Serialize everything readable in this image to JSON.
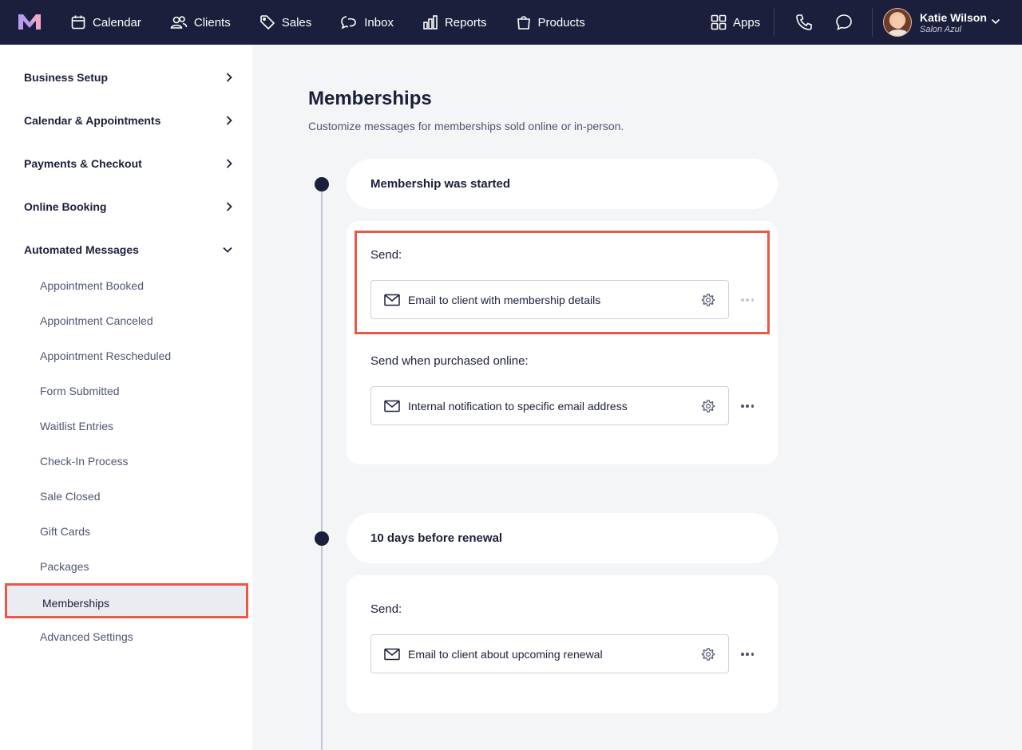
{
  "topnav": {
    "items": [
      {
        "label": "Calendar",
        "icon": "calendar-icon"
      },
      {
        "label": "Clients",
        "icon": "clients-icon"
      },
      {
        "label": "Sales",
        "icon": "tag-icon"
      },
      {
        "label": "Inbox",
        "icon": "chat-icon"
      },
      {
        "label": "Reports",
        "icon": "bar-chart-icon"
      },
      {
        "label": "Products",
        "icon": "shopping-bag-icon"
      }
    ],
    "apps_label": "Apps",
    "user": {
      "name": "Katie Wilson",
      "business": "Salon Azul"
    }
  },
  "sidebar": {
    "sections": [
      {
        "label": "Business Setup",
        "state": "collapsed"
      },
      {
        "label": "Calendar & Appointments",
        "state": "collapsed"
      },
      {
        "label": "Payments & Checkout",
        "state": "collapsed"
      },
      {
        "label": "Online Booking",
        "state": "collapsed"
      },
      {
        "label": "Automated Messages",
        "state": "expanded"
      }
    ],
    "sub_items": [
      "Appointment Booked",
      "Appointment Canceled",
      "Appointment Rescheduled",
      "Form Submitted",
      "Waitlist Entries",
      "Check-In Process",
      "Sale Closed",
      "Gift Cards",
      "Packages",
      "Memberships",
      "Advanced Settings"
    ],
    "active_item": "Memberships"
  },
  "main": {
    "title": "Memberships",
    "subtitle": "Customize messages for memberships sold online or in-person.",
    "events": [
      {
        "title": "Membership was started",
        "groups": [
          {
            "label": "Send:",
            "message": "Email to client with membership details"
          },
          {
            "label": "Send when purchased online:",
            "message": "Internal notification to specific email address"
          }
        ]
      },
      {
        "title": "10 days before renewal",
        "groups": [
          {
            "label": "Send:",
            "message": "Email to client about upcoming renewal"
          }
        ]
      }
    ]
  },
  "colors": {
    "nav_bg": "#1b1f3b",
    "highlight": "#e85a48",
    "page_bg": "#f4f5f7"
  }
}
